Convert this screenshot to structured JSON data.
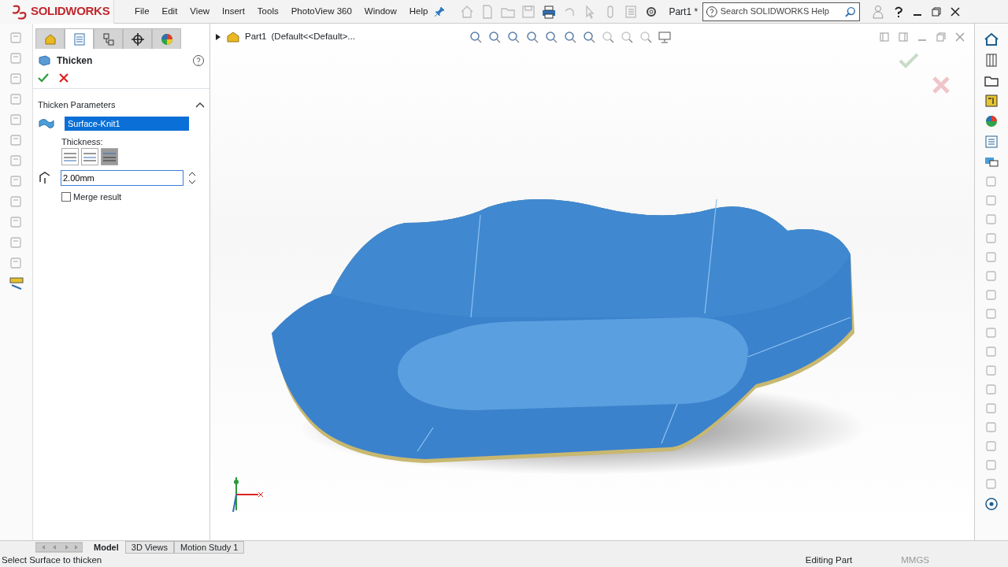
{
  "app": {
    "logo": "SOLIDWORKS"
  },
  "menu": [
    "File",
    "Edit",
    "View",
    "Insert",
    "Tools",
    "PhotoView 360",
    "Window",
    "Help"
  ],
  "document_title": "Part1 *",
  "search": {
    "placeholder": "Search SOLIDWORKS Help"
  },
  "panel_tabs": [
    {
      "selected": false
    },
    {
      "selected": true
    },
    {
      "selected": false
    },
    {
      "selected": false
    },
    {
      "selected": false
    }
  ],
  "property_manager": {
    "title": "Thicken",
    "section": {
      "title": "Thicken Parameters",
      "expanded": true,
      "selection": "Surface-Knit1",
      "thickness_label": "Thickness:",
      "thickness_options": [
        {
          "selected": false
        },
        {
          "selected": false
        },
        {
          "selected": true
        }
      ],
      "thickness_value": "2.00mm",
      "merge": {
        "label": "Merge result",
        "checked": false
      }
    }
  },
  "tree": {
    "part": "Part1",
    "configuration": "(Default<<Default>..."
  },
  "bottom_tabs": [
    {
      "label": "Model",
      "selected": true
    },
    {
      "label": "3D Views",
      "selected": false
    },
    {
      "label": "Motion Study 1",
      "selected": false
    }
  ],
  "status_bar": {
    "message": "Select Surface to thicken",
    "mode": "Editing Part",
    "units": "MMGS"
  }
}
